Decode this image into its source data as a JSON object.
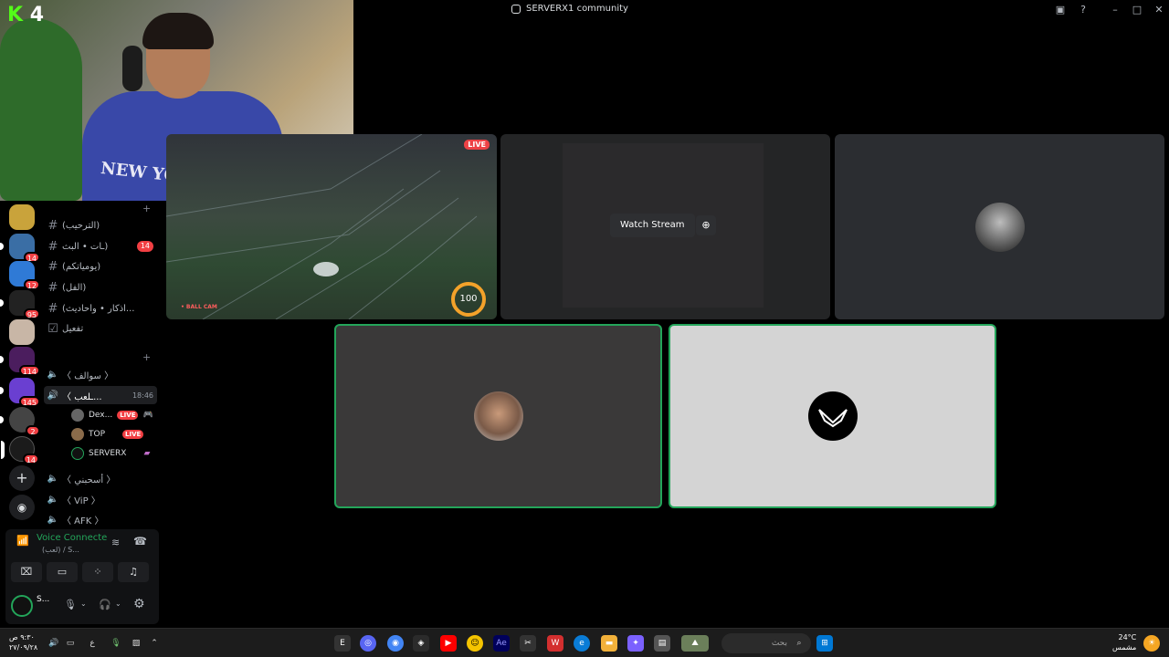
{
  "window": {
    "title": "SERVERX1 community"
  },
  "webcam": {
    "logo_letter": "K",
    "logo_number": "4",
    "hoodie_text": "NEW YORK"
  },
  "servers": [
    {
      "badge": ""
    },
    {
      "badge": "14"
    },
    {
      "badge": "12"
    },
    {
      "badge": "95"
    },
    {
      "badge": ""
    },
    {
      "badge": "114"
    },
    {
      "badge": "145"
    },
    {
      "badge": "2"
    },
    {
      "badge": "14"
    }
  ],
  "channels": {
    "text": [
      {
        "name": "(الترحيب)",
        "badge": ""
      },
      {
        "name": "ـات • البث)",
        "badge": "14"
      },
      {
        "name": "(يومياتكم)",
        "badge": ""
      },
      {
        "name": "(الفل)",
        "badge": ""
      },
      {
        "name": "(أذكار • وأحاديث...",
        "badge": ""
      },
      {
        "name": "تفعيل",
        "badge": ""
      }
    ],
    "voice": [
      {
        "name": "〈 سوالف 〉",
        "time": ""
      },
      {
        "name": "〈 ـلعب...",
        "time": "18:46"
      },
      {
        "name": "〈 أسحبني 〉",
        "time": ""
      },
      {
        "name": "〈 ViP 〉",
        "time": ""
      },
      {
        "name": "〈 AFK 〉",
        "time": ""
      }
    ],
    "voice_users": [
      {
        "name": "Dex...",
        "live": "LIVE"
      },
      {
        "name": "TOP",
        "live": "LIVE"
      },
      {
        "name": "SERVERX",
        "live": ""
      }
    ]
  },
  "voice_panel": {
    "status": "Voice Connecte",
    "sub": "(لعب) / S..."
  },
  "user_panel": {
    "name": "S..."
  },
  "stage": {
    "watch_stream": "Watch Stream",
    "live": "LIVE",
    "ball_cam": "• BALL CAM",
    "boost": "100"
  },
  "taskbar": {
    "time": "٩:٣٠ ص",
    "date": "٢٧/٠٩/٢٨",
    "lang": "ع",
    "search_placeholder": "بحث",
    "temperature": "24°C",
    "weather": "مشمس"
  }
}
